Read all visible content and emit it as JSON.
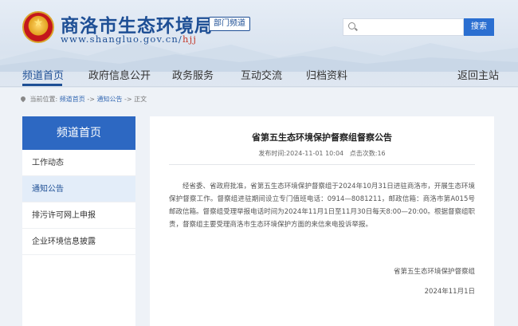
{
  "header": {
    "site_title": "商洛市生态环境局",
    "site_url_prefix": "www.shangluo.gov.cn/",
    "site_url_suffix": "hjj",
    "badge": "部门频道"
  },
  "search": {
    "placeholder": "",
    "button": "搜索"
  },
  "nav": [
    "频道首页",
    "政府信息公开",
    "政务服务",
    "互动交流",
    "归档资料",
    "返回主站"
  ],
  "breadcrumb": {
    "label": "当前位置:",
    "home": "频道首页",
    "sep": "->",
    "section": "通知公告",
    "current": "正文"
  },
  "sidebar": {
    "title": "频道首页",
    "items": [
      "工作动态",
      "通知公告",
      "排污许可网上申报",
      "企业环境信息披露"
    ]
  },
  "article": {
    "title": "省第五生态环境保护督察组督察公告",
    "publish_label": "发布时间:",
    "publish_time": "2024-11-01 10:04",
    "clicks_label": "点击次数:",
    "clicks": "16",
    "body": "经省委、省政府批准，省第五生态环境保护督察组于2024年10月31日进驻商洛市，开展生态环境保护督察工作。督察组进驻期间设立专门值班电话：0914—8081211，邮政信箱：商洛市第A015号邮政信箱。督察组受理举报电话时间为2024年11月1日至11月30日每天8:00—20:00。根据督察组职责，督察组主要受理商洛市生态环境保护方面的来信来电投诉举报。",
    "signature": "省第五生态环境保护督察组",
    "date": "2024年11月1日"
  },
  "colors": {
    "brand": "#1e4f95",
    "accent": "#2d68c2",
    "search_button": "#2b6fd1"
  }
}
